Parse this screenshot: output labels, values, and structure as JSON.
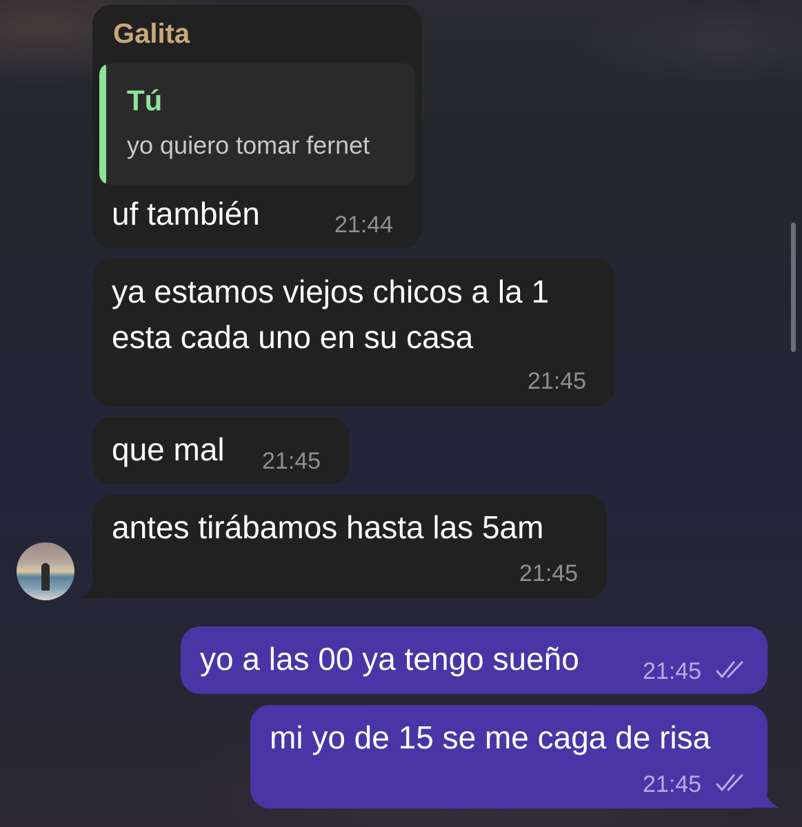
{
  "messages": [
    {
      "sender": "Galita",
      "reply": {
        "author": "Tú",
        "text": "yo quiero tomar fernet"
      },
      "text": "uf también",
      "time": "21:44"
    },
    {
      "lines": [
        "ya estamos viejos chicos a la 1",
        "esta cada uno en su casa"
      ],
      "time": "21:45"
    },
    {
      "text": "que mal",
      "time": "21:45"
    },
    {
      "text": "antes tirábamos hasta las 5am",
      "time": "21:45"
    },
    {
      "text": "yo a las 00 ya tengo sueño",
      "time": "21:45",
      "status": "read"
    },
    {
      "text": "mi yo de 15 se me caga de risa",
      "time": "21:45",
      "status": "read"
    }
  ],
  "colors": {
    "incoming_bubble": "#212121",
    "outgoing_bubble": "#4a35a6",
    "sender_name": "#c9a87a",
    "reply_accent": "#8ee39a"
  },
  "icons": {
    "read_receipt": "double-check-icon",
    "avatar": "contact-avatar"
  }
}
